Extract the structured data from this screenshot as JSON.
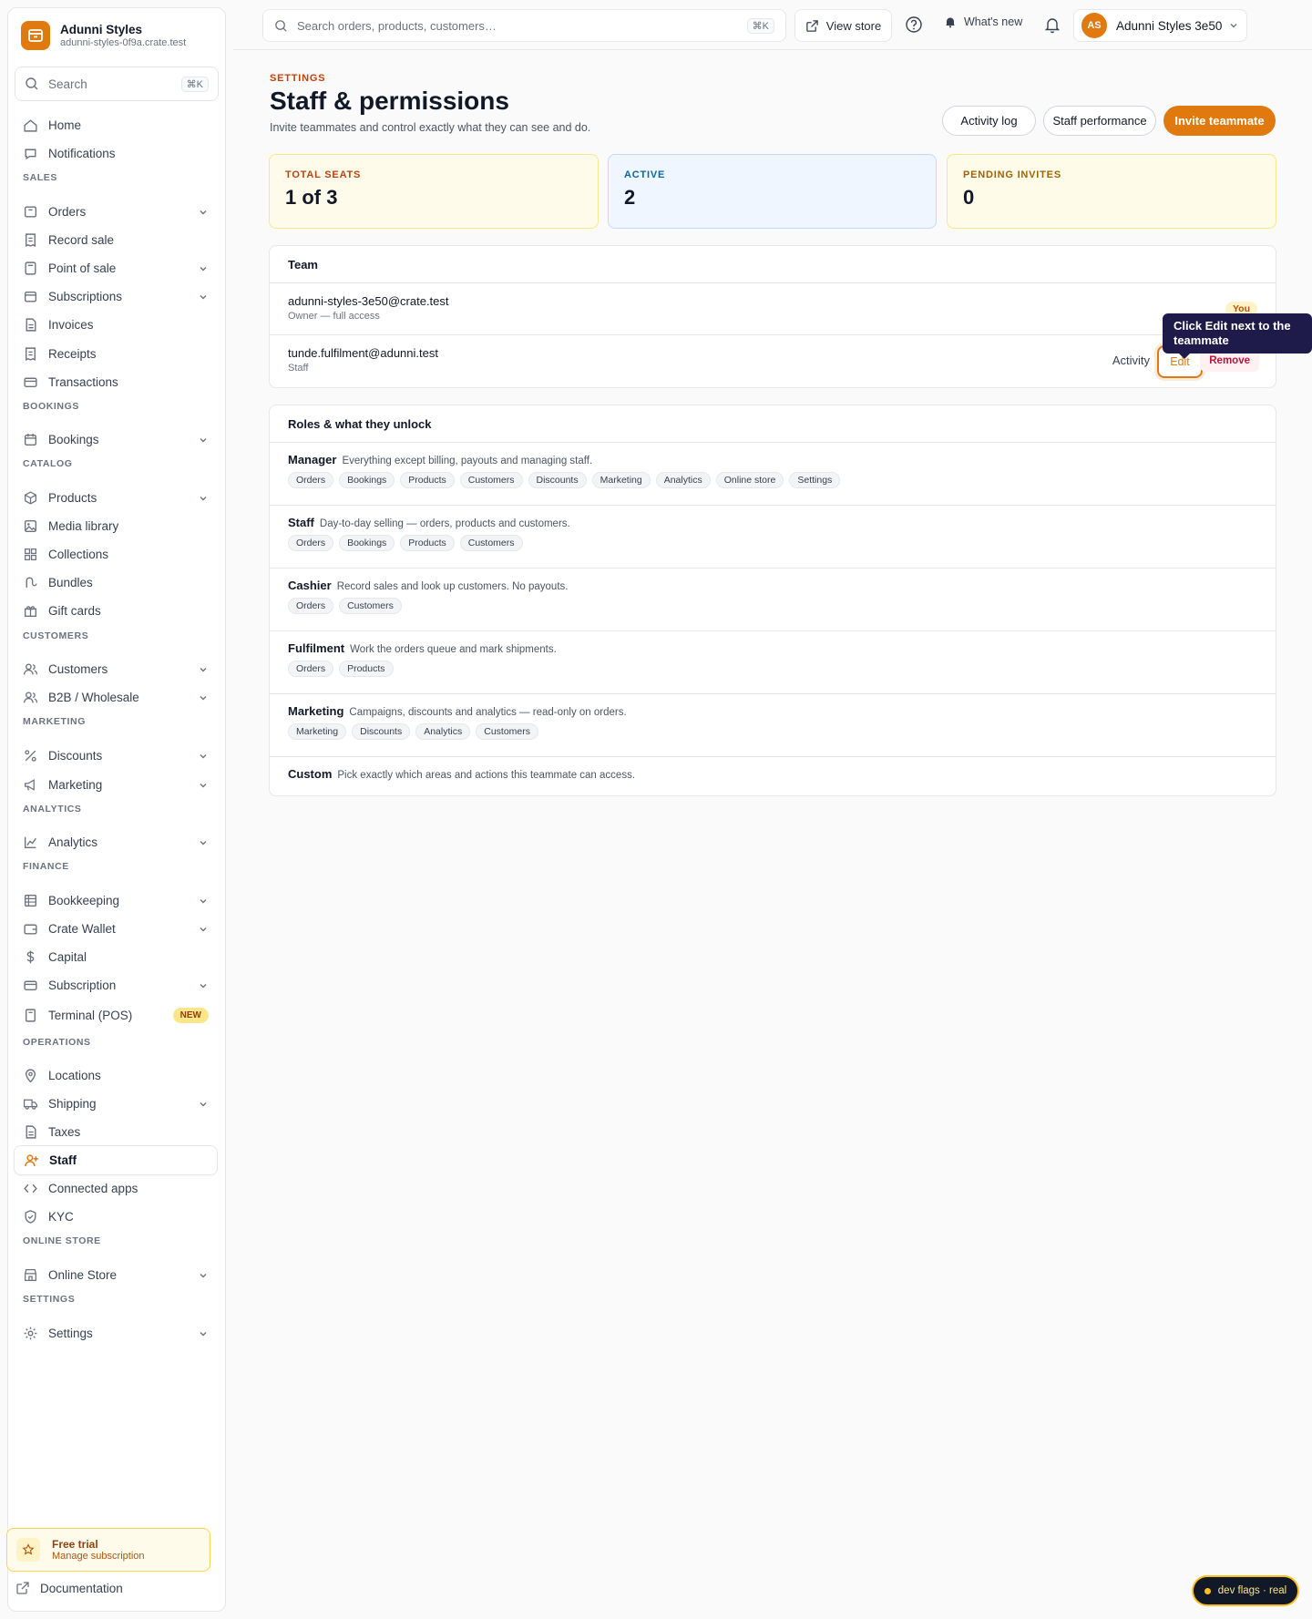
{
  "brand": {
    "name": "Adunni Styles",
    "subdomain": "adunni-styles-0f9a.crate.test"
  },
  "sidebar": {
    "search_placeholder": "Search",
    "search_kbd": "⌘K",
    "items": [
      {
        "label": "Home",
        "icon": "home-icon"
      },
      {
        "label": "Notifications",
        "icon": "chat-bubble-icon"
      },
      {
        "label": "Orders",
        "icon": "box-icon"
      },
      {
        "label": "Record sale",
        "icon": "receipt-icon"
      },
      {
        "label": "Point of sale",
        "icon": "calculator-icon"
      },
      {
        "label": "Subscriptions",
        "icon": "subscription-icon"
      },
      {
        "label": "Invoices",
        "icon": "document-icon"
      },
      {
        "label": "Receipts",
        "icon": "receipt-icon"
      },
      {
        "label": "Transactions",
        "icon": "card-icon"
      },
      {
        "label": "Bookings",
        "icon": "calendar-icon"
      },
      {
        "label": "Products",
        "icon": "cube-icon"
      },
      {
        "label": "Media library",
        "icon": "image-icon"
      },
      {
        "label": "Collections",
        "icon": "grid-icon"
      },
      {
        "label": "Bundles",
        "icon": "bundle-icon"
      },
      {
        "label": "Gift cards",
        "icon": "gift-icon"
      },
      {
        "label": "Customers",
        "icon": "users-icon"
      },
      {
        "label": "B2B / Wholesale",
        "icon": "users-icon"
      },
      {
        "label": "Discounts",
        "icon": "percent-icon"
      },
      {
        "label": "Marketing",
        "icon": "megaphone-icon"
      },
      {
        "label": "Analytics",
        "icon": "chart-line-icon"
      },
      {
        "label": "Bookkeeping",
        "icon": "ledger-icon"
      },
      {
        "label": "Crate Wallet",
        "icon": "wallet-icon"
      },
      {
        "label": "Capital",
        "icon": "dollar-icon"
      },
      {
        "label": "Subscription",
        "icon": "card-icon"
      },
      {
        "label": "Terminal (POS)",
        "icon": "terminal-icon",
        "badge": "NEW"
      },
      {
        "label": "Locations",
        "icon": "pin-icon"
      },
      {
        "label": "Shipping",
        "icon": "truck-icon"
      },
      {
        "label": "Taxes",
        "icon": "document-icon"
      },
      {
        "label": "Staff",
        "icon": "user-plus-icon"
      },
      {
        "label": "Connected apps",
        "icon": "code-icon"
      },
      {
        "label": "KYC",
        "icon": "shield-icon"
      },
      {
        "label": "Online Store",
        "icon": "store-icon"
      },
      {
        "label": "Settings",
        "icon": "gear-icon"
      }
    ],
    "sections": [
      "SALES",
      "BOOKINGS",
      "CATALOG",
      "CUSTOMERS",
      "MARKETING",
      "ANALYTICS",
      "FINANCE",
      "OPERATIONS",
      "ONLINE STORE",
      "SETTINGS"
    ],
    "trial_title": "Free trial",
    "trial_link": "Manage subscription",
    "docs_label": "Documentation"
  },
  "topbar": {
    "search_placeholder": "Search orders, products, customers…",
    "search_kbd": "⌘K",
    "view_store": "View store",
    "whats_new": "What's new",
    "avatar_initials": "AS",
    "account_name": "Adunni Styles 3e50"
  },
  "page": {
    "eyebrow": "SETTINGS",
    "title": "Staff & permissions",
    "subtitle": "Invite teammates and control exactly what they can see and do.",
    "btn_activity_log": "Activity log",
    "btn_staff_performance": "Staff performance",
    "btn_invite": "Invite teammate"
  },
  "stats": [
    {
      "label": "TOTAL SEATS",
      "value": "1 of 3"
    },
    {
      "label": "ACTIVE",
      "value": "2"
    },
    {
      "label": "PENDING INVITES",
      "value": "0"
    }
  ],
  "team": {
    "title": "Team",
    "members": [
      {
        "email": "adunni-styles-3e50@crate.test",
        "role": "Owner — full access",
        "badge": "You"
      },
      {
        "email": "tunde.fulfilment@adunni.test",
        "role": "Staff",
        "activity": "Activity",
        "edit": "Edit",
        "remove": "Remove"
      }
    ]
  },
  "roles": {
    "title": "Roles & what they unlock",
    "items": [
      {
        "name": "Manager",
        "desc": "Everything except billing, payouts and managing staff.",
        "chips": [
          "Orders",
          "Bookings",
          "Products",
          "Customers",
          "Discounts",
          "Marketing",
          "Analytics",
          "Online store",
          "Settings"
        ]
      },
      {
        "name": "Staff",
        "desc": "Day-to-day selling — orders, products and customers.",
        "chips": [
          "Orders",
          "Bookings",
          "Products",
          "Customers"
        ]
      },
      {
        "name": "Cashier",
        "desc": "Record sales and look up customers. No payouts.",
        "chips": [
          "Orders",
          "Customers"
        ]
      },
      {
        "name": "Fulfilment",
        "desc": "Work the orders queue and mark shipments.",
        "chips": [
          "Orders",
          "Products"
        ]
      },
      {
        "name": "Marketing",
        "desc": "Campaigns, discounts and analytics — read-only on orders.",
        "chips": [
          "Marketing",
          "Discounts",
          "Analytics",
          "Customers"
        ]
      },
      {
        "name": "Custom",
        "desc": "Pick exactly which areas and actions this teammate can access.",
        "chips": []
      }
    ]
  },
  "tooltip": "Click Edit next to the teammate",
  "devflags": "dev flags · real",
  "colors": {
    "accent": "#e07a0e",
    "tooltip_bg": "#1e1b4b"
  }
}
